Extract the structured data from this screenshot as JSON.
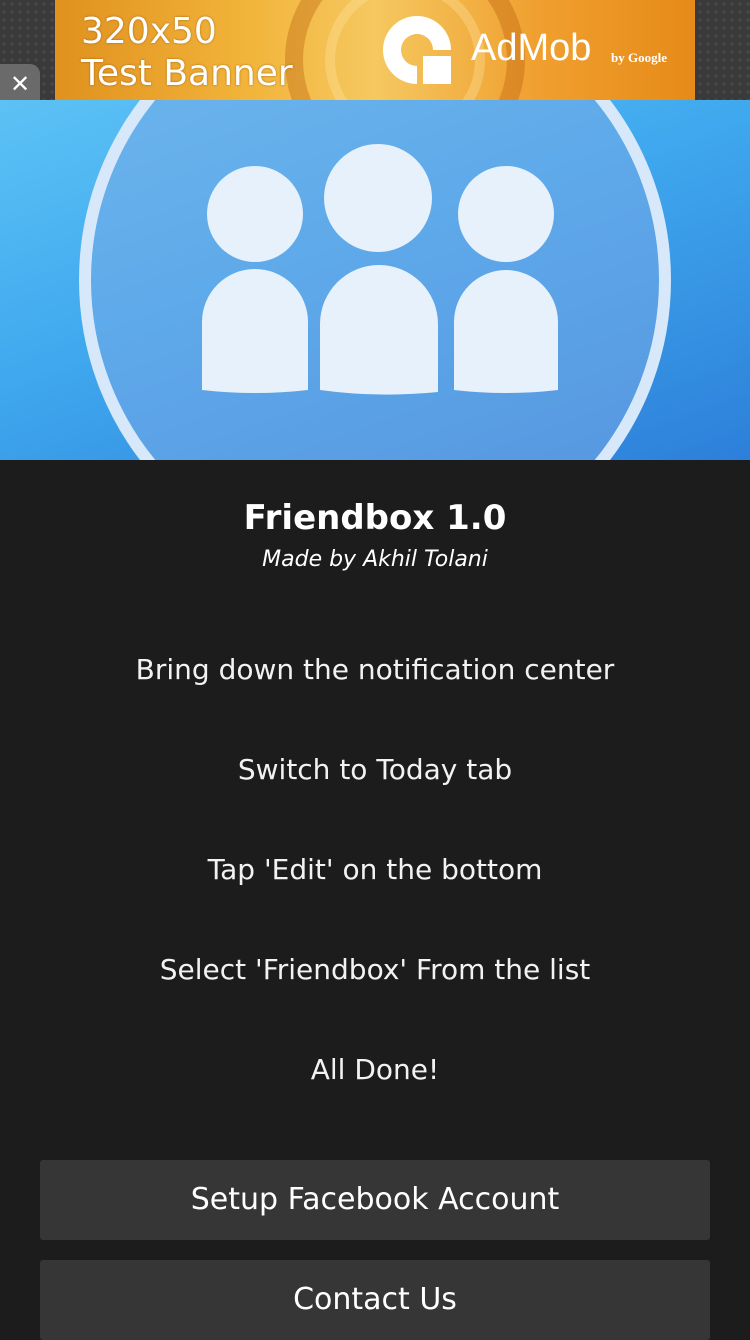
{
  "ad": {
    "line1": "320x50",
    "line2": "Test Banner",
    "brand": "AdMob",
    "brand_sub": "by Google",
    "close_label": "✕"
  },
  "app": {
    "title": "Friendbox 1.0",
    "subtitle": "Made by Akhil Tolani"
  },
  "steps": [
    "Bring down the notification center",
    "Switch to Today tab",
    "Tap 'Edit' on the bottom",
    "Select 'Friendbox' From the list",
    "All Done!"
  ],
  "buttons": {
    "setup_facebook": "Setup Facebook Account",
    "contact_us": "Contact Us"
  },
  "colors": {
    "background": "#1c1c1c",
    "button": "#363636",
    "hero_top": "#5cc2f5",
    "hero_bottom": "#2d7fd9",
    "ad_orange": "#f2b43a"
  },
  "icons": {
    "ad_close": "close-icon",
    "hero": "friends-group-icon",
    "ad_logo": "admob-logo-icon"
  }
}
